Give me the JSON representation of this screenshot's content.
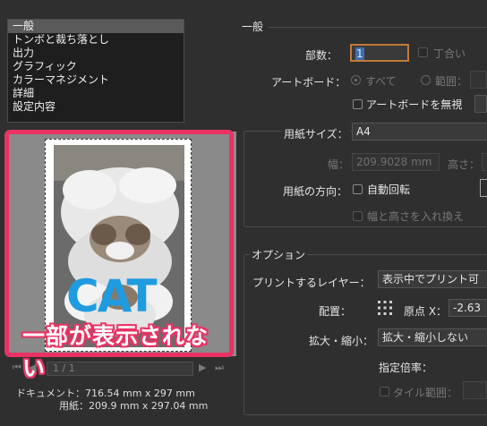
{
  "categories": [
    "一般",
    "トンボと裁ち落とし",
    "出力",
    "グラフィック",
    "カラーマネジメント",
    "詳細",
    "設定内容"
  ],
  "preview": {
    "overlay_text": "CAT",
    "annotation": "一部が表示されない",
    "page_indicator": "1 / 1",
    "document_label": "ドキュメント：716.54 mm x 297 mm",
    "paper_label": "用紙：209.9 mm x 297.04 mm"
  },
  "general": {
    "section_title": "一般",
    "copies_label": "部数：",
    "copies_value": "1",
    "collate_label": "丁合い",
    "artboard_label": "アートボード：",
    "all_label": "すべて",
    "range_label": "範囲：",
    "ignore_artboards_label": "アートボードを無視",
    "paper_size_label": "用紙サイズ：",
    "paper_size_value": "A4",
    "width_label": "幅：",
    "width_value": "209.9028 mm",
    "height_label": "高さ：",
    "orientation_label": "用紙の方向：",
    "auto_rotate_label": "自動回転",
    "transverse_label": "幅と高さを入れ換え"
  },
  "options": {
    "section_title": "オプション",
    "print_layers_label": "プリントするレイヤー：",
    "print_layers_value": "表示中でプリント可",
    "placement_label": "配置：",
    "origin_x_label": "原点 X：",
    "origin_x_value": "-2.63",
    "scaling_label": "拡大・縮小：",
    "scaling_value": "拡大・縮小しない",
    "custom_scale_label": "指定倍率：",
    "tile_range_label": "タイル範囲："
  },
  "colors": {
    "highlight": "#ea3264",
    "cat_text": "#1f9be0",
    "background": "#2f2f2f"
  }
}
